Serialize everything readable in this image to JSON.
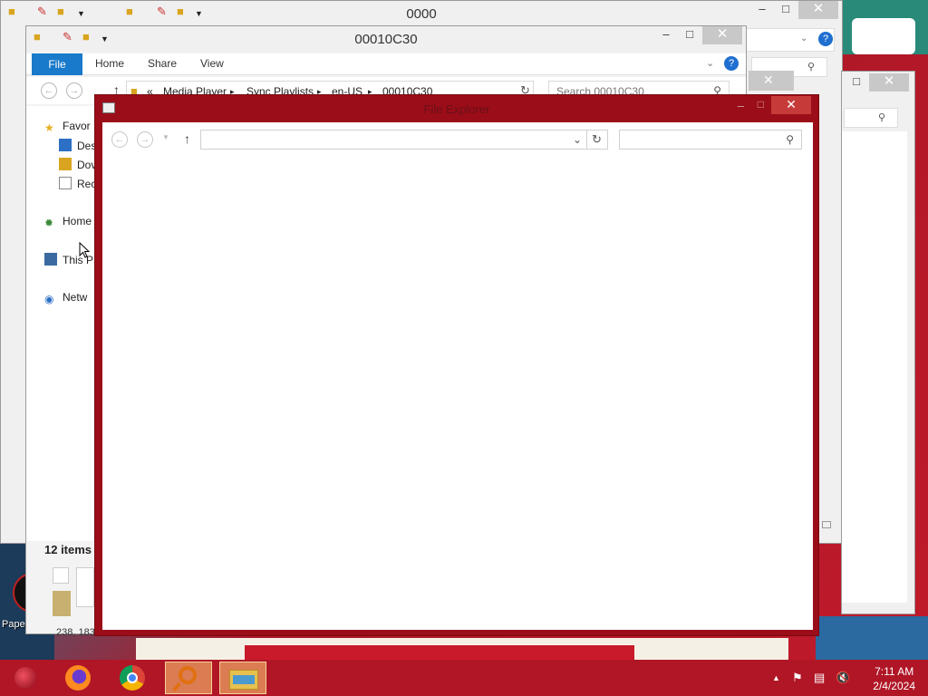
{
  "back_window": {
    "title": "0000"
  },
  "middle_window": {
    "title": "00010C30",
    "ribbon_tabs": [
      "File",
      "Home",
      "Share",
      "View"
    ],
    "breadcrumb": [
      "«",
      "Media Player",
      "Sync Playlists",
      "en-US",
      "00010C30"
    ],
    "search_placeholder": "Search 00010C30",
    "nav_items": [
      "Favor",
      "Des",
      "Dov",
      "Rec",
      "Home",
      "This P",
      "Netw"
    ],
    "status_text": "12 items"
  },
  "dialog": {
    "title": "File Explorer",
    "address_value": "",
    "search_value": ""
  },
  "desktop": {
    "icon_label": "Papers, P",
    "coord_text": "238, 183"
  },
  "taskbar": {
    "apps": [
      "start-orb-icon",
      "firefox-icon",
      "chrome-icon",
      "search-app-icon",
      "file-explorer-icon"
    ],
    "time": "7:11 AM",
    "date": "2/4/2024"
  },
  "colors": {
    "dialog_frame": "#9b0d18",
    "taskbar": "#b01626",
    "ribbon_file_tab": "#1979ca",
    "close_button": "#c73a3a"
  }
}
